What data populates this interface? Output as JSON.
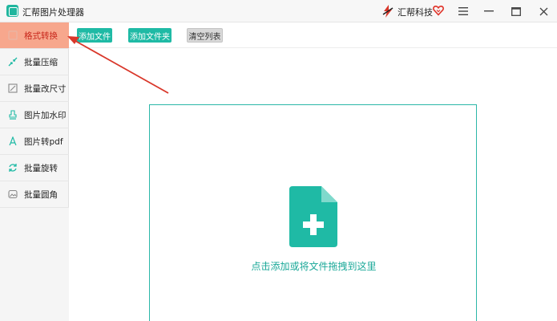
{
  "window": {
    "title": "汇帮图片处理器",
    "brand": "汇帮科技"
  },
  "sidebar": {
    "items": [
      {
        "label": "格式转换",
        "icon": "format-convert-icon",
        "active": true
      },
      {
        "label": "批量压缩",
        "icon": "compress-icon"
      },
      {
        "label": "批量改尺寸",
        "icon": "resize-icon"
      },
      {
        "label": "图片加水印",
        "icon": "watermark-icon"
      },
      {
        "label": "图片转pdf",
        "icon": "pdf-icon"
      },
      {
        "label": "批量旋转",
        "icon": "rotate-icon"
      },
      {
        "label": "批量圆角",
        "icon": "rounded-corner-icon"
      }
    ]
  },
  "toolbar": {
    "add_file": "添加文件",
    "add_folder": "添加文件夹",
    "clear_list": "清空列表"
  },
  "dropzone": {
    "text": "点击添加或将文件拖拽到这里"
  },
  "colors": {
    "accent": "#1fbaa5",
    "active_bg": "#f7a78d",
    "active_text": "#c8281c",
    "arrow": "#d9372a"
  }
}
